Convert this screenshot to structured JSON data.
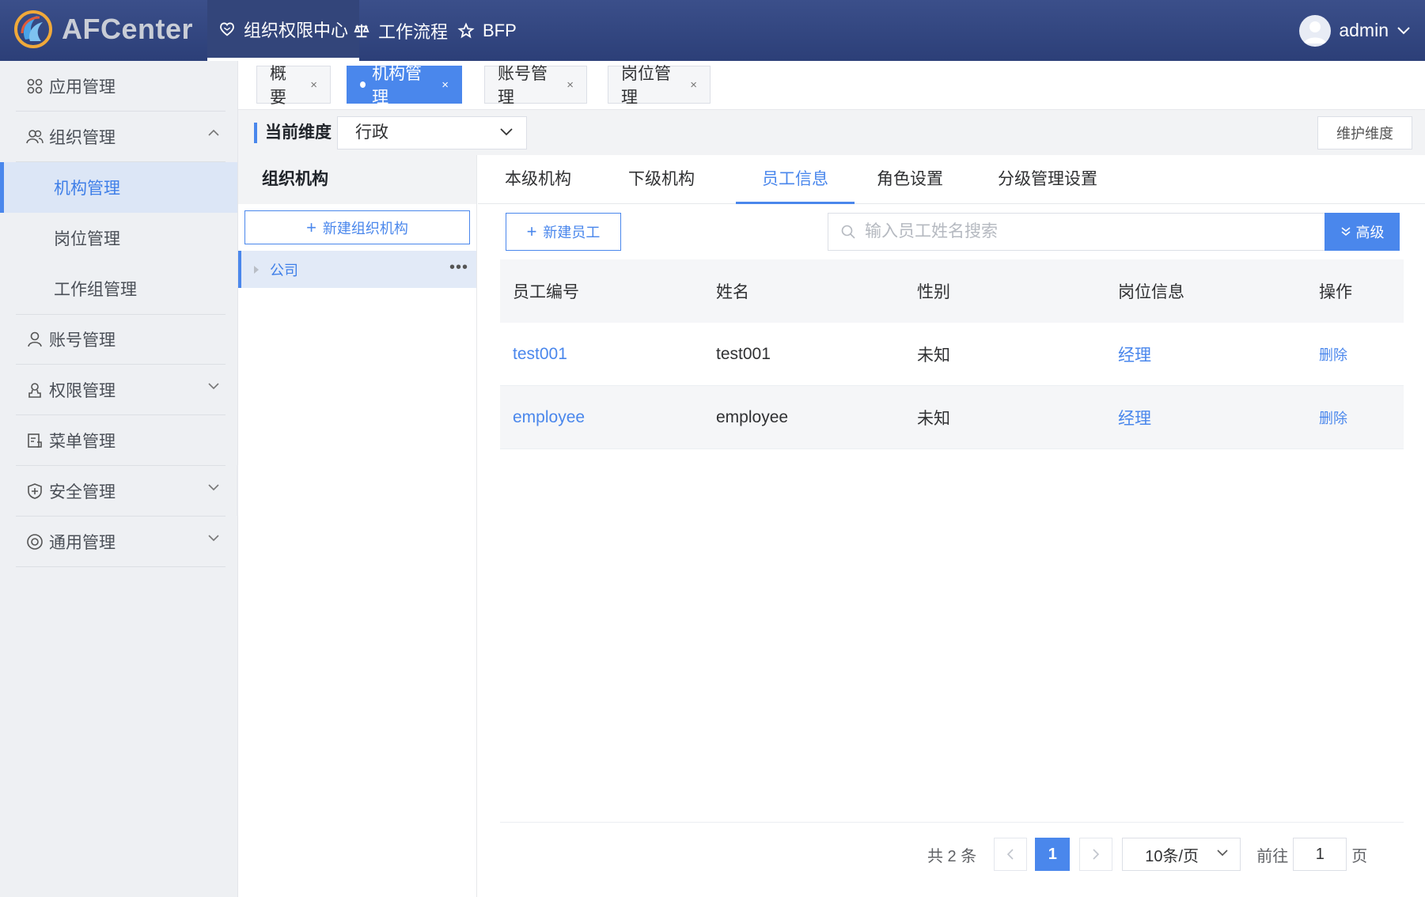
{
  "app": {
    "name": "AFCenter"
  },
  "topnav": [
    {
      "label": "组织权限中心",
      "icon": "heart-icon",
      "active": true
    },
    {
      "label": "工作流程",
      "icon": "scale-icon",
      "active": false
    },
    {
      "label": "BFP",
      "icon": "star-icon",
      "active": false
    }
  ],
  "user": {
    "name": "admin"
  },
  "sidebar": {
    "items": [
      {
        "label": "应用管理",
        "icon": "grid-icon"
      },
      {
        "label": "组织管理",
        "icon": "users-icon",
        "expanded": true
      },
      {
        "label": "机构管理",
        "sub": true,
        "active": true
      },
      {
        "label": "岗位管理",
        "sub": true
      },
      {
        "label": "工作组管理",
        "sub": true
      },
      {
        "label": "账号管理",
        "icon": "user-icon"
      },
      {
        "label": "权限管理",
        "icon": "permission-icon"
      },
      {
        "label": "菜单管理",
        "icon": "menu-icon"
      },
      {
        "label": "安全管理",
        "icon": "shield-icon"
      },
      {
        "label": "通用管理",
        "icon": "settings-icon"
      }
    ]
  },
  "tabs": [
    {
      "label": "概要",
      "active": false
    },
    {
      "label": "机构管理",
      "active": true
    },
    {
      "label": "账号管理",
      "active": false
    },
    {
      "label": "岗位管理",
      "active": false
    }
  ],
  "tab_close": "×",
  "dimension": {
    "label": "当前维度",
    "value": "行政",
    "maintain_button": "维护维度"
  },
  "org": {
    "title": "组织机构",
    "new_button": "新建组织机构",
    "tree": [
      {
        "label": "公司"
      }
    ]
  },
  "subtabs": [
    "本级机构",
    "下级机构",
    "员工信息",
    "角色设置",
    "分级管理设置"
  ],
  "active_subtab": "员工信息",
  "employees": {
    "new_button": "新建员工",
    "search_placeholder": "输入员工姓名搜索",
    "advanced_button": "高级",
    "columns": [
      "员工编号",
      "姓名",
      "性别",
      "岗位信息",
      "操作"
    ],
    "rows": [
      {
        "id": "test001",
        "name": "test001",
        "gender": "未知",
        "position": "经理",
        "action": "删除"
      },
      {
        "id": "employee",
        "name": "employee",
        "gender": "未知",
        "position": "经理",
        "action": "删除"
      }
    ]
  },
  "pagination": {
    "total_text": "共 2 条",
    "current_page": "1",
    "page_size": "10条/页",
    "goto_prefix": "前往",
    "goto_value": "1",
    "goto_suffix": "页"
  },
  "colors": {
    "topbar": "#2c3f78",
    "accent": "#4a87ec",
    "sidebar_bg": "#eef0f3"
  }
}
